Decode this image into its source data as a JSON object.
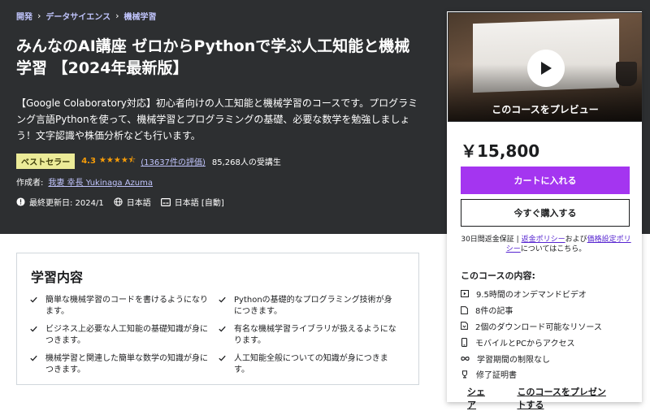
{
  "breadcrumb": [
    "開発",
    "データサイエンス",
    "機械学習"
  ],
  "course": {
    "title": "みんなのAI講座 ゼロからPythonで学ぶ人工知能と機械学習 【2024年最新版】",
    "description": "【Google Colaboratory対応】初心者向けの人工知能と機械学習のコースです。プログラミング言語Pythonを使って、機械学習とプログラミングの基礎、必要な数学を勉強しましょう！文字認識や株価分析なども行います。",
    "badge": "ベストセラー",
    "rating": "4.3",
    "stars": "★★★★⯪",
    "reviews": "(13637件の評価)",
    "students": "85,268人の受講生",
    "author_label": "作成者:",
    "author": "我妻 幸長 Yukinaga Azuma",
    "updated": "最終更新日: 2024/1",
    "language": "日本語",
    "captions": "日本語 [自動]"
  },
  "sidebar": {
    "preview_label": "このコースをプレビュー",
    "price": "￥15,800",
    "cart_button": "カートに入れる",
    "buy_button": "今すぐ購入する",
    "guarantee_prefix": "30日間返金保証",
    "refund_policy": "返金ポリシー",
    "and": "および",
    "pricing_policy": "価格設定ポリシー",
    "guarantee_suffix": "についてはこちら。",
    "includes_title": "このコースの内容:",
    "includes": [
      {
        "icon": "video-icon",
        "label": "9.5時間のオンデマンドビデオ"
      },
      {
        "icon": "file-icon",
        "label": "8件の記事"
      },
      {
        "icon": "download-icon",
        "label": "2個のダウンロード可能なリソース"
      },
      {
        "icon": "mobile-icon",
        "label": "モバイルとPCからアクセス"
      },
      {
        "icon": "infinity-icon",
        "label": "学習期間の制限なし"
      },
      {
        "icon": "trophy-icon",
        "label": "修了証明書"
      }
    ],
    "share": "シェア",
    "gift": "このコースをプレゼントする"
  },
  "learn": {
    "title": "学習内容",
    "items": [
      "簡単な機械学習のコードを書けるようになります。",
      "Pythonの基礎的なプログラミング技術が身につきます。",
      "ビジネス上必要な人工知能の基礎知識が身につきます。",
      "有名な機械学習ライブラリが扱えるようになります。",
      "機械学習と関連した簡単な数学の知識が身につきます。",
      "人工知能全般についての知識が身につきます。"
    ]
  },
  "colors": {
    "hero_bg": "#2d2f31",
    "accent": "#a435f0",
    "link": "#c0c4fc",
    "star": "#f69c08",
    "badge_bg": "#eceb98"
  }
}
